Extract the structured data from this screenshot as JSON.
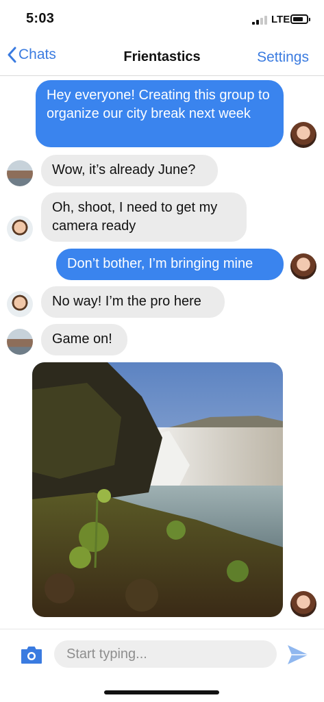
{
  "status": {
    "time": "5:03",
    "network": "LTE",
    "battery_level": 0.8
  },
  "nav": {
    "back_label": "Chats",
    "title": "Frientastics",
    "settings_label": "Settings"
  },
  "messages": [
    {
      "text": "Hey everyone! Creating this group to organize our city break next week",
      "direction": "outgoing",
      "avatar": "woman-avatar"
    },
    {
      "text": "Wow, it’s already June?",
      "direction": "incoming",
      "avatar": "group-photo-avatar"
    },
    {
      "text": "Oh, shoot, I need to get my camera ready",
      "direction": "incoming",
      "avatar": "man-avatar"
    },
    {
      "text": "Don’t bother, I’m bringing mine",
      "direction": "outgoing",
      "avatar": "woman-avatar"
    },
    {
      "text": "No way! I’m the pro here",
      "direction": "incoming",
      "avatar": "man-avatar"
    },
    {
      "text": "Game on!",
      "direction": "incoming",
      "avatar": "group-photo-avatar"
    },
    {
      "type": "image",
      "subject": "waterfall-landscape-photo",
      "direction": "outgoing",
      "avatar": "woman-avatar"
    }
  ],
  "composer": {
    "placeholder": "Start typing...",
    "camera_icon": "camera-icon",
    "send_icon": "send-icon"
  },
  "colors": {
    "accent": "#3a7be0",
    "outgoing_bubble": "#3a84ee",
    "incoming_bubble": "#ebebeb"
  }
}
